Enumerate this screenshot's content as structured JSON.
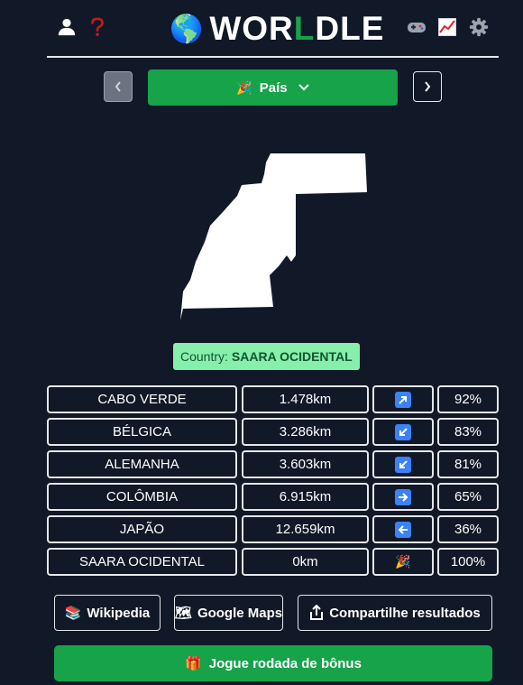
{
  "header": {
    "title_pre": "WOR",
    "title_l": "L",
    "title_post": "DLE",
    "globe_icon": "🌎",
    "accent_color": "#16a34a"
  },
  "mode_selector": {
    "label": "País",
    "emoji": "🎉"
  },
  "country_reveal": {
    "label": "Country:",
    "value": "SAARA OCIDENTAL"
  },
  "guesses": [
    {
      "name": "CABO VERDE",
      "distance": "1.478km",
      "direction": "north-east-arrow",
      "percent": "92%"
    },
    {
      "name": "BÉLGICA",
      "distance": "3.286km",
      "direction": "south-west-arrow",
      "percent": "83%"
    },
    {
      "name": "ALEMANHA",
      "distance": "3.603km",
      "direction": "south-west-arrow",
      "percent": "81%"
    },
    {
      "name": "COLÔMBIA",
      "distance": "6.915km",
      "direction": "east-arrow",
      "percent": "65%"
    },
    {
      "name": "JAPÃO",
      "distance": "12.659km",
      "direction": "west-arrow",
      "percent": "36%"
    },
    {
      "name": "SAARA OCIDENTAL",
      "distance": "0km",
      "direction": "party-popper",
      "percent": "100%"
    }
  ],
  "buttons": {
    "wikipedia": "Wikipedia",
    "google_maps": "Google Maps",
    "share": "Compartilhe resultados",
    "bonus": "Jogue rodada de bônus"
  },
  "emojis": {
    "wiki": "📚",
    "maps": "🗺",
    "party": "🎉",
    "gift": "🎁"
  }
}
